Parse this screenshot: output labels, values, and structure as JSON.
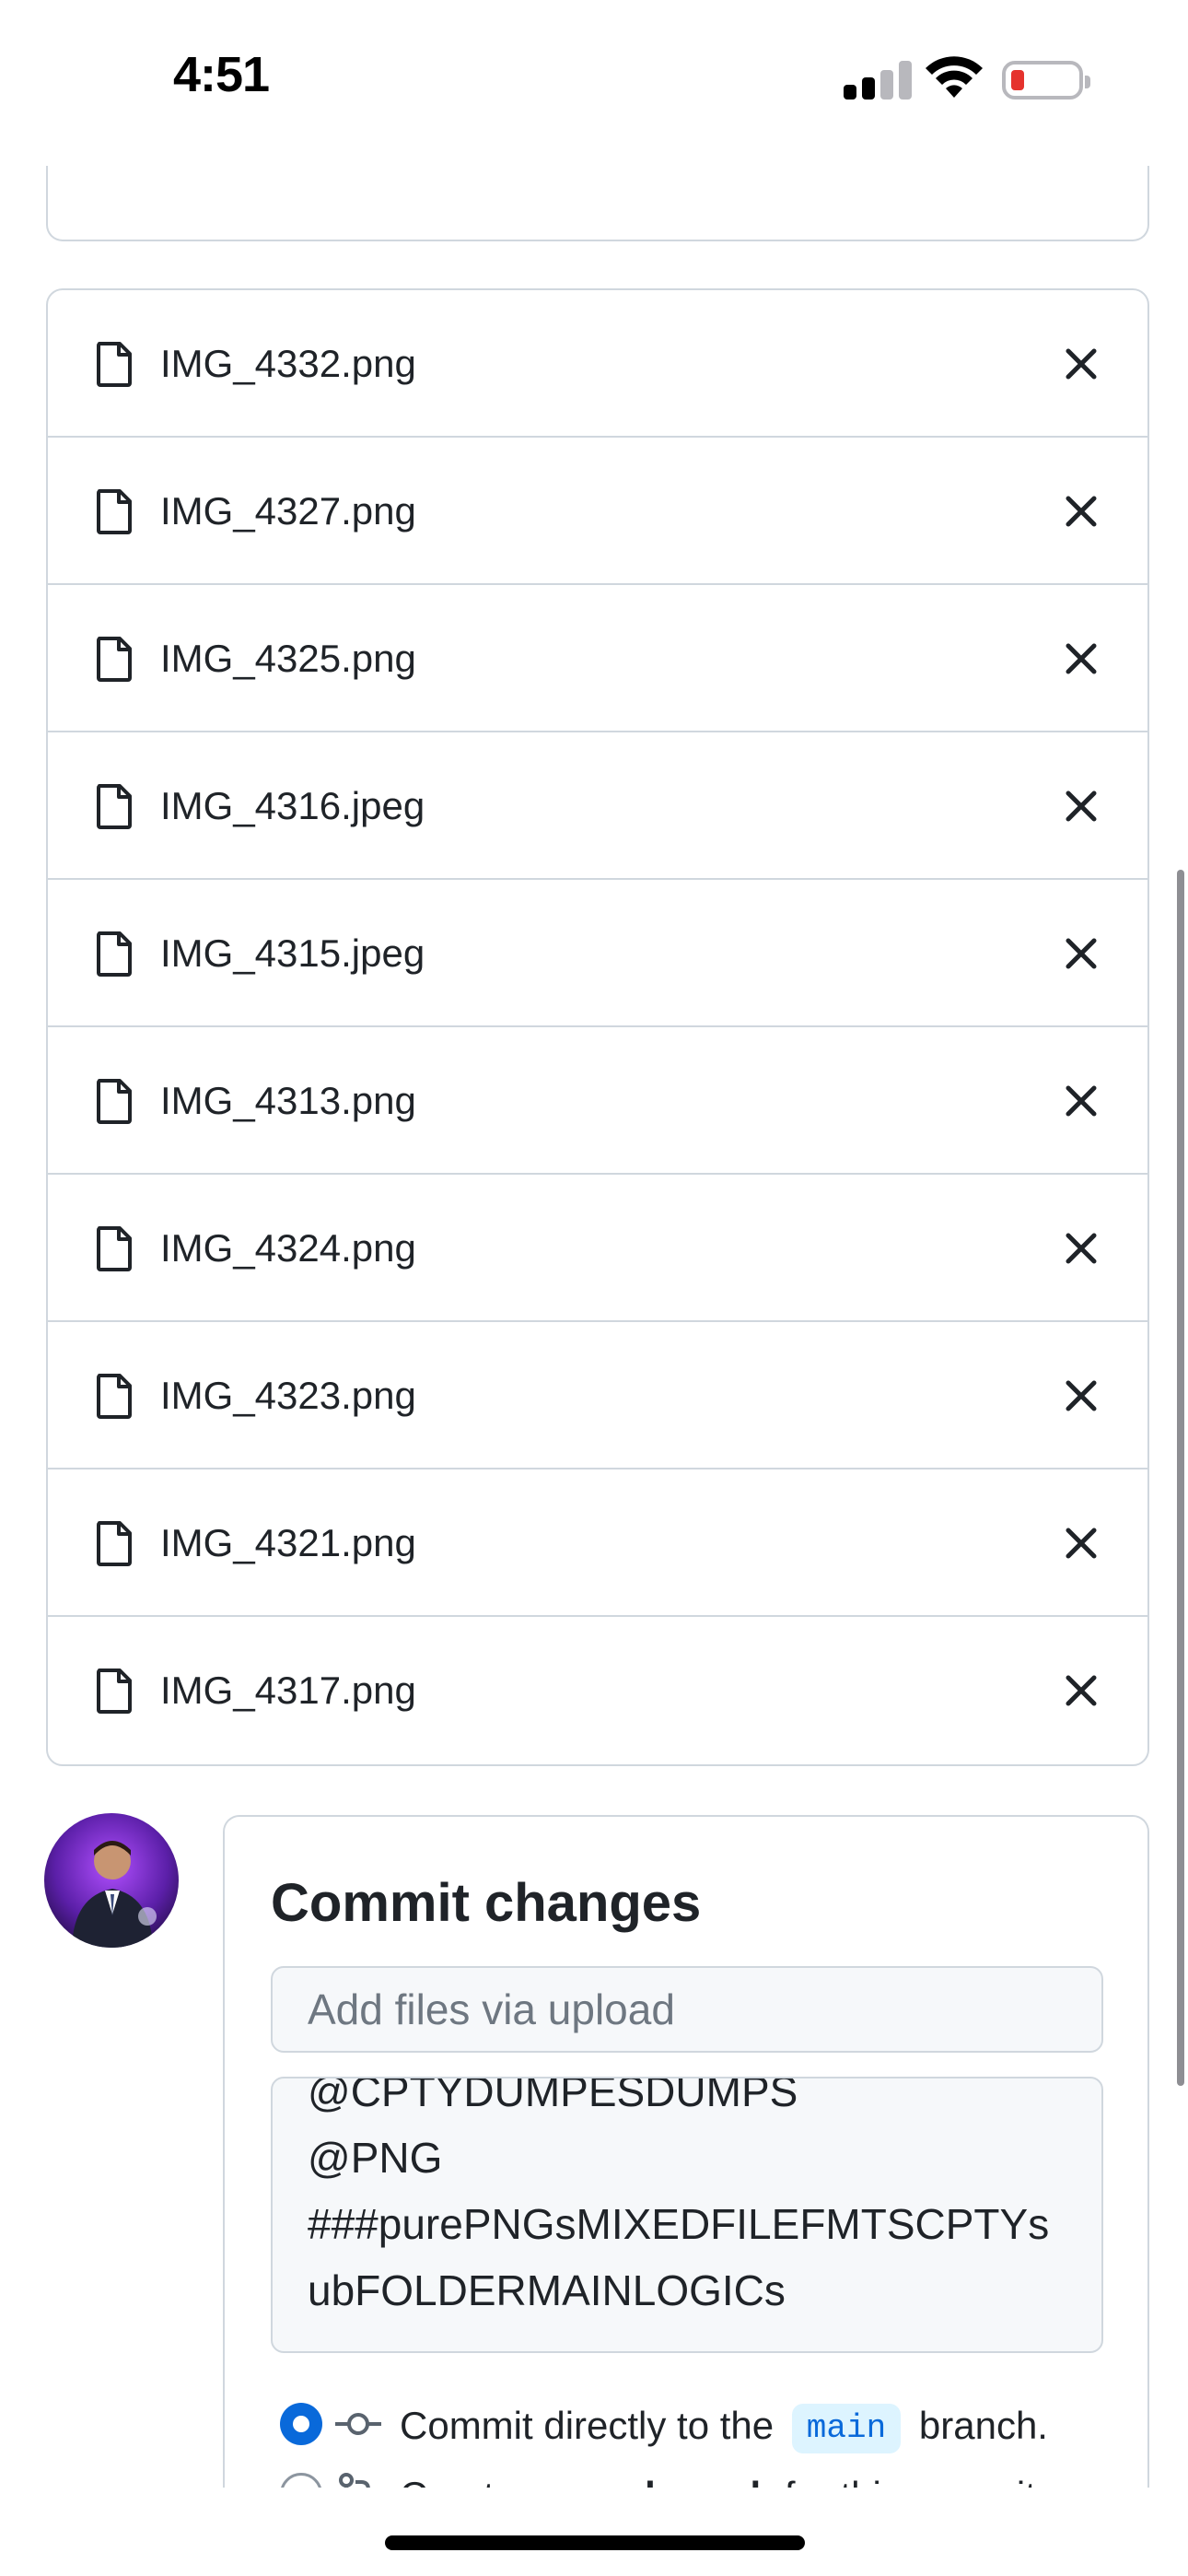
{
  "status_bar": {
    "time": "4:51",
    "signal_icon": "cellular-signal-icon",
    "wifi_icon": "wifi-icon",
    "battery_icon": "battery-low-icon",
    "battery_level": 0.15
  },
  "files": {
    "items": [
      {
        "name": "IMG_4332.png"
      },
      {
        "name": "IMG_4327.png"
      },
      {
        "name": "IMG_4325.png"
      },
      {
        "name": "IMG_4316.jpeg"
      },
      {
        "name": "IMG_4315.jpeg"
      },
      {
        "name": "IMG_4313.png"
      },
      {
        "name": "IMG_4324.png"
      },
      {
        "name": "IMG_4323.png"
      },
      {
        "name": "IMG_4321.png"
      },
      {
        "name": "IMG_4317.png"
      }
    ],
    "file_icon": "file-icon",
    "remove_icon": "close-icon"
  },
  "commit": {
    "title": "Commit changes",
    "summary_placeholder": "Add files via upload",
    "description": "@CPTYDUMPESDUMPS\n@PNG\n###purePNGsMIXEDFILEFMTSCPTYsubFOLDERMAINLOGICs",
    "option_direct": {
      "prefix": "Commit directly to the",
      "branch": "main",
      "suffix": "branch."
    },
    "option_new_branch": {
      "prefix": "Create a",
      "bold": "new branch",
      "suffix": "for this commit"
    }
  },
  "colors": {
    "accent": "#0969da",
    "border": "#d0d7de",
    "input_bg": "#f6f8fa",
    "branch_pill_bg": "#ddf4ff"
  }
}
